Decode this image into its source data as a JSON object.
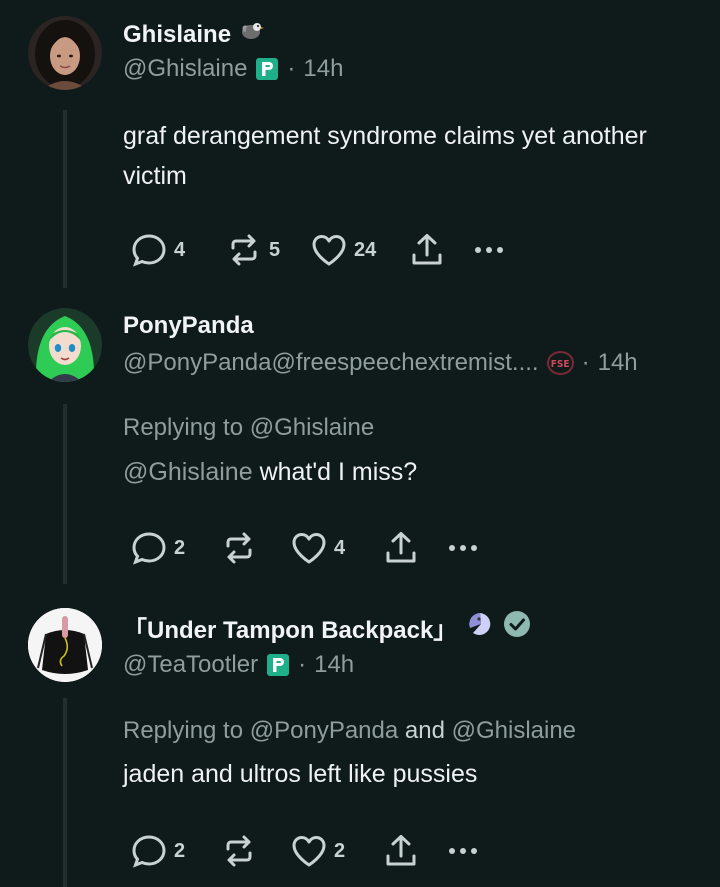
{
  "posts": [
    {
      "display_name": "Ghislaine",
      "name_emoji": "dove-emoji",
      "handle": "@Ghislaine",
      "instance_badge": "p-badge",
      "time": "14h",
      "replying_label": "",
      "replying_to": [],
      "mention": "",
      "text": "graf derangement syndrome claims yet another victim",
      "counts": {
        "replies": "4",
        "reposts": "5",
        "likes": "24"
      }
    },
    {
      "display_name": "PonyPanda",
      "handle": "@PonyPanda@freespeechextremist....",
      "instance_badge": "FSE",
      "time": "14h",
      "replying_label": "Replying to",
      "replying_to": [
        "@Ghislaine"
      ],
      "mention": "@Ghislaine",
      "text": "what'd I miss?",
      "counts": {
        "replies": "2",
        "reposts": "",
        "likes": "4"
      }
    },
    {
      "display_name": "「Under Tampon Backpack」",
      "name_emoji": "pacman-emoji",
      "verified": true,
      "handle": "@TeaTootler",
      "instance_badge": "p-badge",
      "time": "14h",
      "replying_label": "Replying to",
      "replying_to": [
        "@PonyPanda",
        "@Ghislaine"
      ],
      "replying_joiner": "and",
      "mention": "",
      "text": "jaden and ultros left like pussies",
      "counts": {
        "replies": "2",
        "reposts": "",
        "likes": "2"
      }
    }
  ],
  "separator": "·",
  "colors": {
    "background": "#0f1a1a",
    "muted": "#8f9d9c",
    "text": "#eef2f2",
    "verified": "#8fb8b0",
    "p_badge": "#1fb08a",
    "fse_badge": "#d04a5e"
  }
}
